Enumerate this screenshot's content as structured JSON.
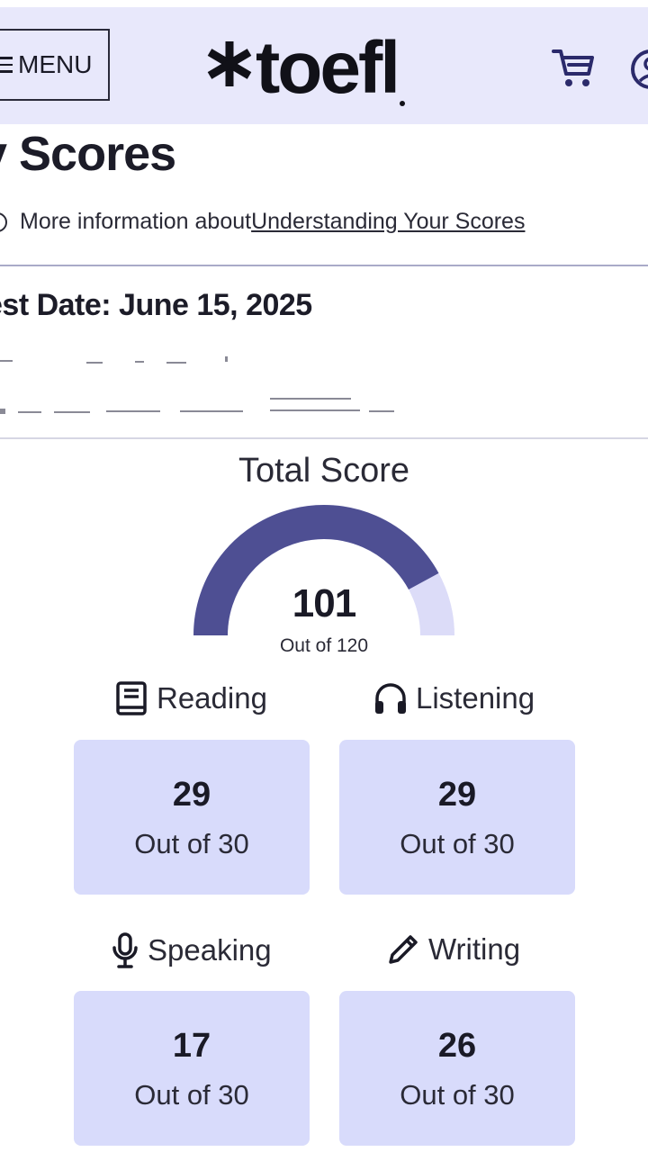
{
  "header": {
    "menu_label": "MENU",
    "logo_text": "toefl",
    "icons": [
      "hamburger-icon",
      "asterisk-logo-icon",
      "cart-icon",
      "account-icon"
    ]
  },
  "page": {
    "title": "My Scores",
    "title_visible": "y Scores",
    "info_prefix": "More information about ",
    "info_link": "Understanding Your Scores",
    "test_date_visible": "est Date: June 15, 2025"
  },
  "total": {
    "title": "Total Score",
    "value": "101",
    "out_of": "Out of 120",
    "fraction": 0.8417
  },
  "sections": [
    {
      "name": "Reading",
      "icon": "book-icon",
      "score": "29",
      "out_of": "Out of 30"
    },
    {
      "name": "Listening",
      "icon": "headphones-icon",
      "score": "29",
      "out_of": "Out of 30"
    },
    {
      "name": "Speaking",
      "icon": "microphone-icon",
      "score": "17",
      "out_of": "Out of 30"
    },
    {
      "name": "Writing",
      "icon": "pencil-icon",
      "score": "26",
      "out_of": "Out of 30"
    }
  ],
  "colors": {
    "header_bg": "#e8e8fb",
    "gauge_fill": "#4e4f93",
    "gauge_track": "#dcdcf8",
    "card_bg": "#d8dbfb"
  }
}
